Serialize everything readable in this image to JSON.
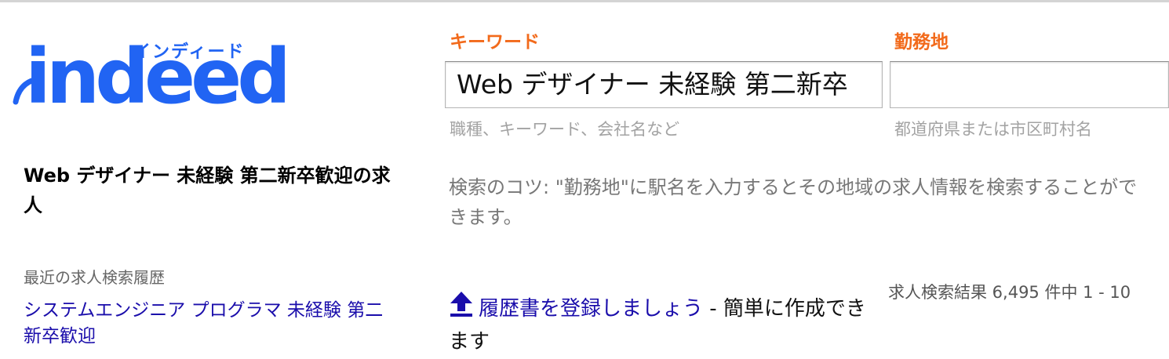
{
  "logo": {
    "wordmark": "indeed",
    "japanese": "インディード",
    "brand_color": "#2164f3"
  },
  "search": {
    "keyword_label": "キーワード",
    "keyword_value": "Web デザイナー 未経験 第二新卒",
    "keyword_hint": "職種、キーワード、会社名など",
    "location_label": "勤務地",
    "location_value": "",
    "location_hint": "都道府県または市区町村名",
    "label_color": "#f26a1b"
  },
  "page_title": "Web デザイナー 未経験 第二新卒歓迎の求人",
  "tip": "検索のコツ: \"勤務地\"に駅名を入力するとその地域の求人情報を検索することができます。",
  "recent": {
    "title": "最近の求人検索履歴",
    "items": [
      "システムエンジニア プログラマ 未経験 第二新卒歓迎"
    ]
  },
  "resume": {
    "icon": "upload-arrow-icon",
    "link_text": "履歴書を登録しましょう",
    "suffix": " - 簡単に作成できます"
  },
  "results_count": "求人検索結果 6,495 件中 1 - 10"
}
